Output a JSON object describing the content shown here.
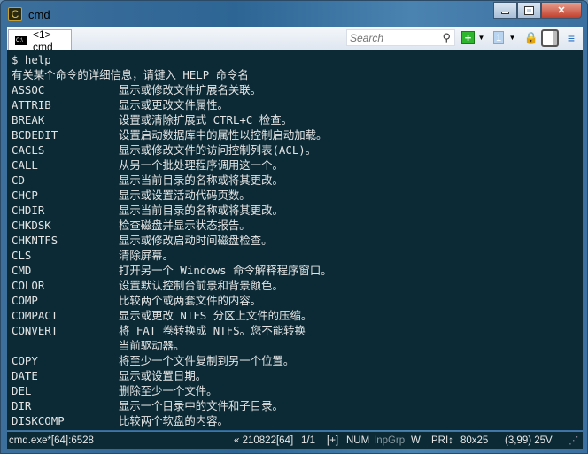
{
  "window": {
    "title": "cmd"
  },
  "tab": {
    "label": "<1> cmd"
  },
  "search": {
    "placeholder": "Search"
  },
  "terminal": {
    "prompt": "$ help",
    "intro": "有关某个命令的详细信息，请键入 HELP 命令名",
    "commands": [
      {
        "name": "ASSOC",
        "desc": "显示或修改文件扩展名关联。"
      },
      {
        "name": "ATTRIB",
        "desc": "显示或更改文件属性。"
      },
      {
        "name": "BREAK",
        "desc": "设置或清除扩展式 CTRL+C 检查。"
      },
      {
        "name": "BCDEDIT",
        "desc": "设置启动数据库中的属性以控制启动加载。"
      },
      {
        "name": "CACLS",
        "desc": "显示或修改文件的访问控制列表(ACL)。"
      },
      {
        "name": "CALL",
        "desc": "从另一个批处理程序调用这一个。"
      },
      {
        "name": "CD",
        "desc": "显示当前目录的名称或将其更改。"
      },
      {
        "name": "CHCP",
        "desc": "显示或设置活动代码页数。"
      },
      {
        "name": "CHDIR",
        "desc": "显示当前目录的名称或将其更改。"
      },
      {
        "name": "CHKDSK",
        "desc": "检查磁盘并显示状态报告。"
      },
      {
        "name": "CHKNTFS",
        "desc": "显示或修改启动时间磁盘检查。"
      },
      {
        "name": "CLS",
        "desc": "清除屏幕。"
      },
      {
        "name": "CMD",
        "desc": "打开另一个 Windows 命令解释程序窗口。"
      },
      {
        "name": "COLOR",
        "desc": "设置默认控制台前景和背景颜色。"
      },
      {
        "name": "COMP",
        "desc": "比较两个或两套文件的内容。"
      },
      {
        "name": "COMPACT",
        "desc": "显示或更改 NTFS 分区上文件的压缩。"
      },
      {
        "name": "CONVERT",
        "desc": "将 FAT 卷转换成 NTFS。您不能转换"
      },
      {
        "name": "",
        "desc": "当前驱动器。"
      },
      {
        "name": "COPY",
        "desc": "将至少一个文件复制到另一个位置。"
      },
      {
        "name": "DATE",
        "desc": "显示或设置日期。"
      },
      {
        "name": "DEL",
        "desc": "删除至少一个文件。"
      },
      {
        "name": "DIR",
        "desc": "显示一个目录中的文件和子目录。"
      },
      {
        "name": "DISKCOMP",
        "desc": "比较两个软盘的内容。"
      }
    ]
  },
  "status": {
    "process": "cmd.exe*[64]:6528",
    "build": "« 210822[64]",
    "pages": "1/1",
    "plus": "[+]",
    "num": "NUM",
    "inpgrp": "InpGrp",
    "w": "W",
    "pri": "PRI↕",
    "size": "80x25",
    "cursor": "(3,99) 25V"
  },
  "colors": {
    "terminal_bg": "#0b2a35",
    "terminal_fg": "#e4e4e4"
  }
}
